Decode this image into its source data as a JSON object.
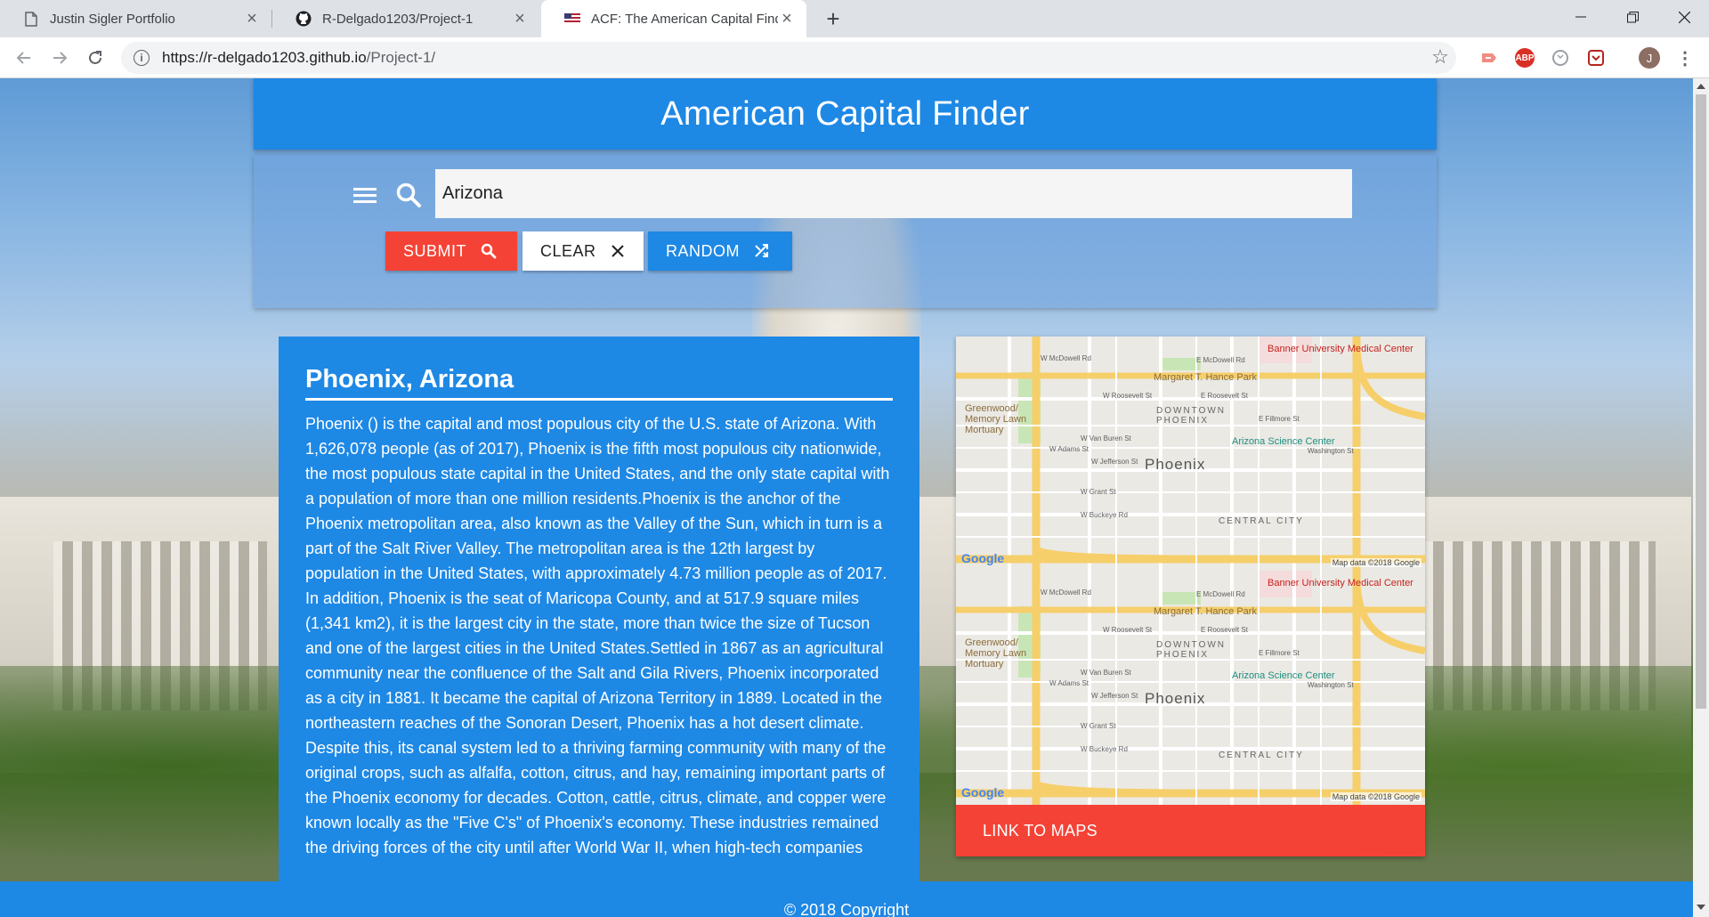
{
  "browser": {
    "tabs": [
      {
        "title": "Justin Sigler Portfolio",
        "icon": "page-icon"
      },
      {
        "title": "R-Delgado1203/Project-1",
        "icon": "github-icon"
      },
      {
        "title": "ACF: The American Capital Finder",
        "icon": "us-flag-icon",
        "active": true
      }
    ],
    "url_host": "https://r-delgado1203.github.io",
    "url_path": "/Project-1/",
    "extensions": [
      "abp-icon",
      "adblock-label"
    ],
    "abp_label": "ABP",
    "profile_initial": "J"
  },
  "header": {
    "title": "American Capital Finder"
  },
  "search": {
    "value": "Arizona",
    "submit_label": "SUBMIT",
    "clear_label": "CLEAR",
    "random_label": "RANDOM"
  },
  "result": {
    "title": "Phoenix, Arizona",
    "description": "Phoenix () is the capital and most populous city of the U.S. state of Arizona. With 1,626,078 people (as of 2017), Phoenix is the fifth most populous city nationwide, the most populous state capital in the United States, and the only state capital with a population of more than one million residents.Phoenix is the anchor of the Phoenix metropolitan area, also known as the Valley of the Sun, which in turn is a part of the Salt River Valley. The metropolitan area is the 12th largest by population in the United States, with approximately 4.73 million people as of 2017. In addition, Phoenix is the seat of Maricopa County, and at 517.9 square miles (1,341 km2), it is the largest city in the state, more than twice the size of Tucson and one of the largest cities in the United States.Settled in 1867 as an agricultural community near the confluence of the Salt and Gila Rivers, Phoenix incorporated as a city in 1881. It became the capital of Arizona Territory in 1889. Located in the northeastern reaches of the Sonoran Desert, Phoenix has a hot desert climate. Despite this, its canal system led to a thriving farming community with many of the original crops, such as alfalfa, cotton, citrus, and hay, remaining important parts of the Phoenix economy for decades. Cotton, cattle, citrus, climate, and copper were known locally as the \"Five C's\" of Phoenix's economy. These industries remained the driving forces of the city until after World War II, when high-tech companies"
  },
  "map": {
    "city_label": "Phoenix",
    "labels": {
      "banner": "Banner University Medical Center",
      "hance_park": "Margaret T. Hance Park",
      "greenwood": "Greenwood/ Memory Lawn Mortuary",
      "downtown": "DOWNTOWN PHOENIX",
      "science": "Arizona Science Center",
      "central": "CENTRAL CITY",
      "mcdowell": "W McDowell Rd",
      "e_mcdowell": "E McDowell Rd",
      "roosevelt": "W Roosevelt St",
      "e_roosevelt": "E Roosevelt St",
      "van_buren": "W Van Buren St",
      "adams": "W Adams St",
      "jefferson": "W Jefferson St",
      "grant": "W Grant St",
      "buckeye": "W Buckeye Rd",
      "washington": "Washington St",
      "fillmore": "E Fillmore St"
    },
    "google": "Google",
    "attribution": "Map data ©2018 Google",
    "link_label": "LINK TO MAPS"
  },
  "footer": {
    "copyright": "© 2018 Copyright"
  },
  "colors": {
    "primary_blue": "#1e88e5",
    "accent_red": "#f44336"
  }
}
